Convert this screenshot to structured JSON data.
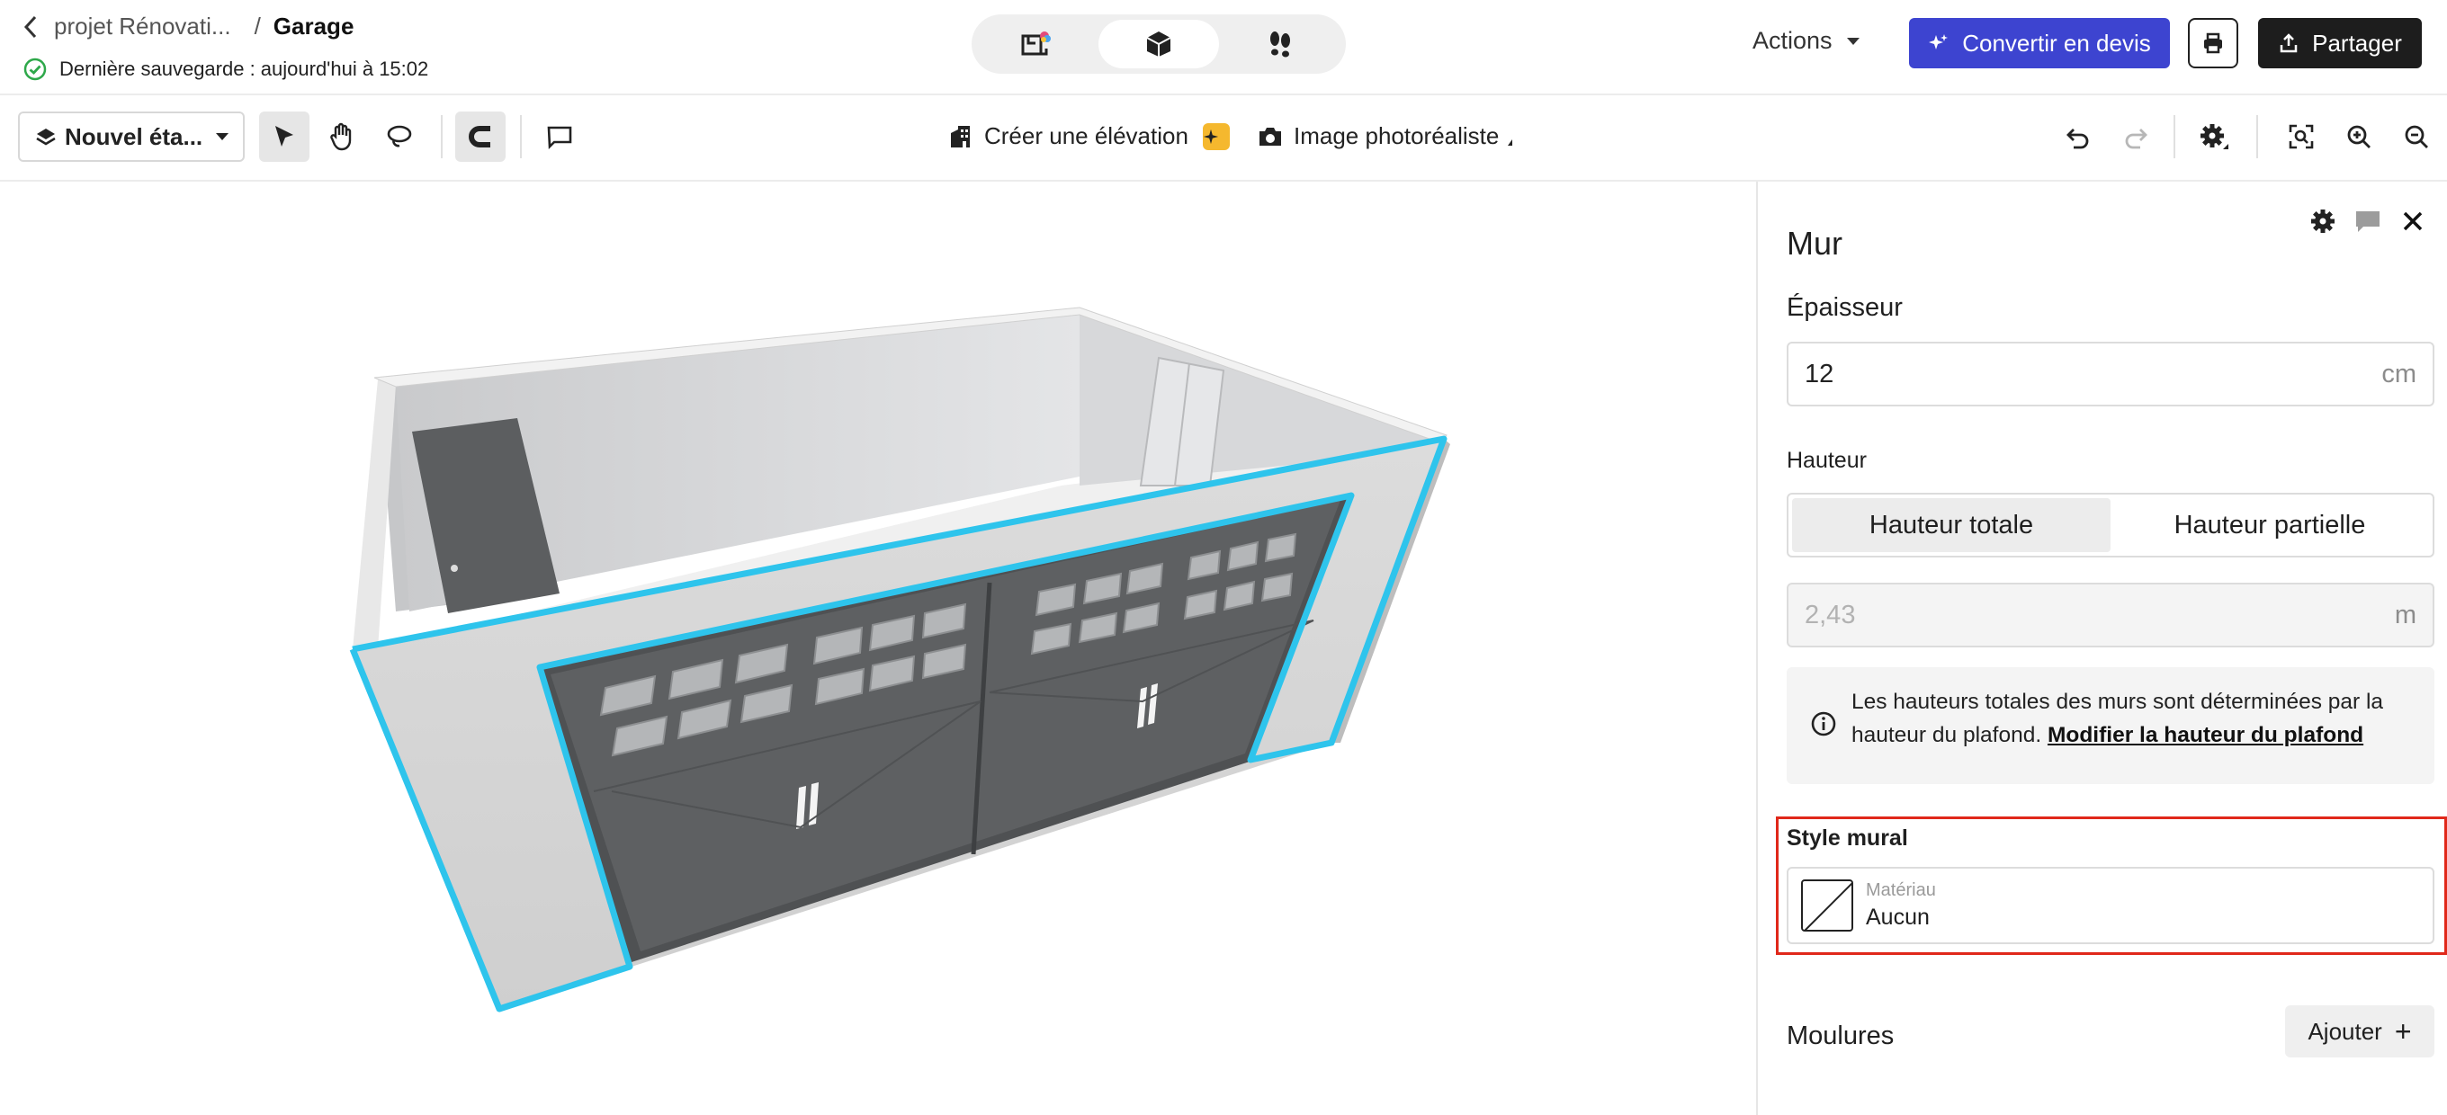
{
  "header": {
    "breadcrumb_project": "projet Rénovati...",
    "breadcrumb_sep": "/",
    "breadcrumb_page": "Garage",
    "save_status": "Dernière sauvegarde : aujourd'hui à 15:02",
    "view_modes": [
      "plan-2d-icon",
      "view-3d-icon",
      "walkthrough-icon"
    ],
    "active_view": 1,
    "actions_label": "Actions",
    "convert_label": "Convertir en devis",
    "share_label": "Partager",
    "accent_color": "#3d44d0"
  },
  "toolbar": {
    "floor_label": "Nouvel éta...",
    "elevation_label": "Créer une élévation",
    "photo_label": "Image photoréaliste"
  },
  "panel": {
    "title": "Mur",
    "thickness_label": "Épaisseur",
    "thickness_value": "12",
    "thickness_unit": "cm",
    "height_label": "Hauteur",
    "height_modes": [
      "Hauteur totale",
      "Hauteur partielle"
    ],
    "height_value": "2,43",
    "height_unit": "m",
    "info_text": "Les hauteurs totales des murs sont déterminées par la hauteur du plafond.",
    "info_link": "Modifier la hauteur du plafond",
    "style_label": "Style mural",
    "material_label": "Matériau",
    "material_value": "Aucun",
    "mouldings_label": "Moulures",
    "add_label": "Ajouter",
    "highlight_color": "#e0281a"
  },
  "scene": {
    "selection_color": "#2ec4ec"
  }
}
